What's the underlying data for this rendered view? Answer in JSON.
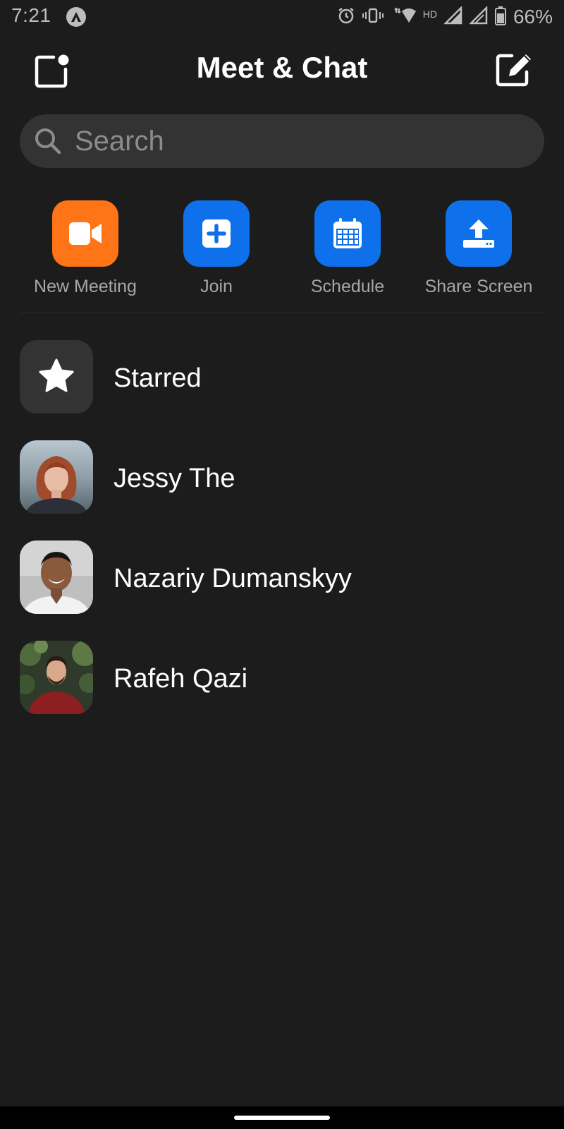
{
  "status_bar": {
    "time": "7:21",
    "network_label": "HD",
    "battery": "66%"
  },
  "header": {
    "title": "Meet & Chat"
  },
  "search": {
    "placeholder": "Search"
  },
  "actions": [
    {
      "label": "New Meeting",
      "icon": "video-camera-icon",
      "color": "#FF7416"
    },
    {
      "label": "Join",
      "icon": "plus-icon",
      "color": "#0E71EB"
    },
    {
      "label": "Schedule",
      "icon": "calendar-icon",
      "color": "#0E71EB"
    },
    {
      "label": "Share Screen",
      "icon": "upload-icon",
      "color": "#0E71EB"
    }
  ],
  "contacts": [
    {
      "name": "Starred",
      "icon": "star-icon"
    },
    {
      "name": "Jessy The"
    },
    {
      "name": "Nazariy Dumanskyy"
    },
    {
      "name": "Rafeh Qazi"
    }
  ],
  "colors": {
    "background": "#1C1C1C",
    "search_bg": "#333333",
    "accent_orange": "#FF7416",
    "accent_blue": "#0E71EB"
  }
}
